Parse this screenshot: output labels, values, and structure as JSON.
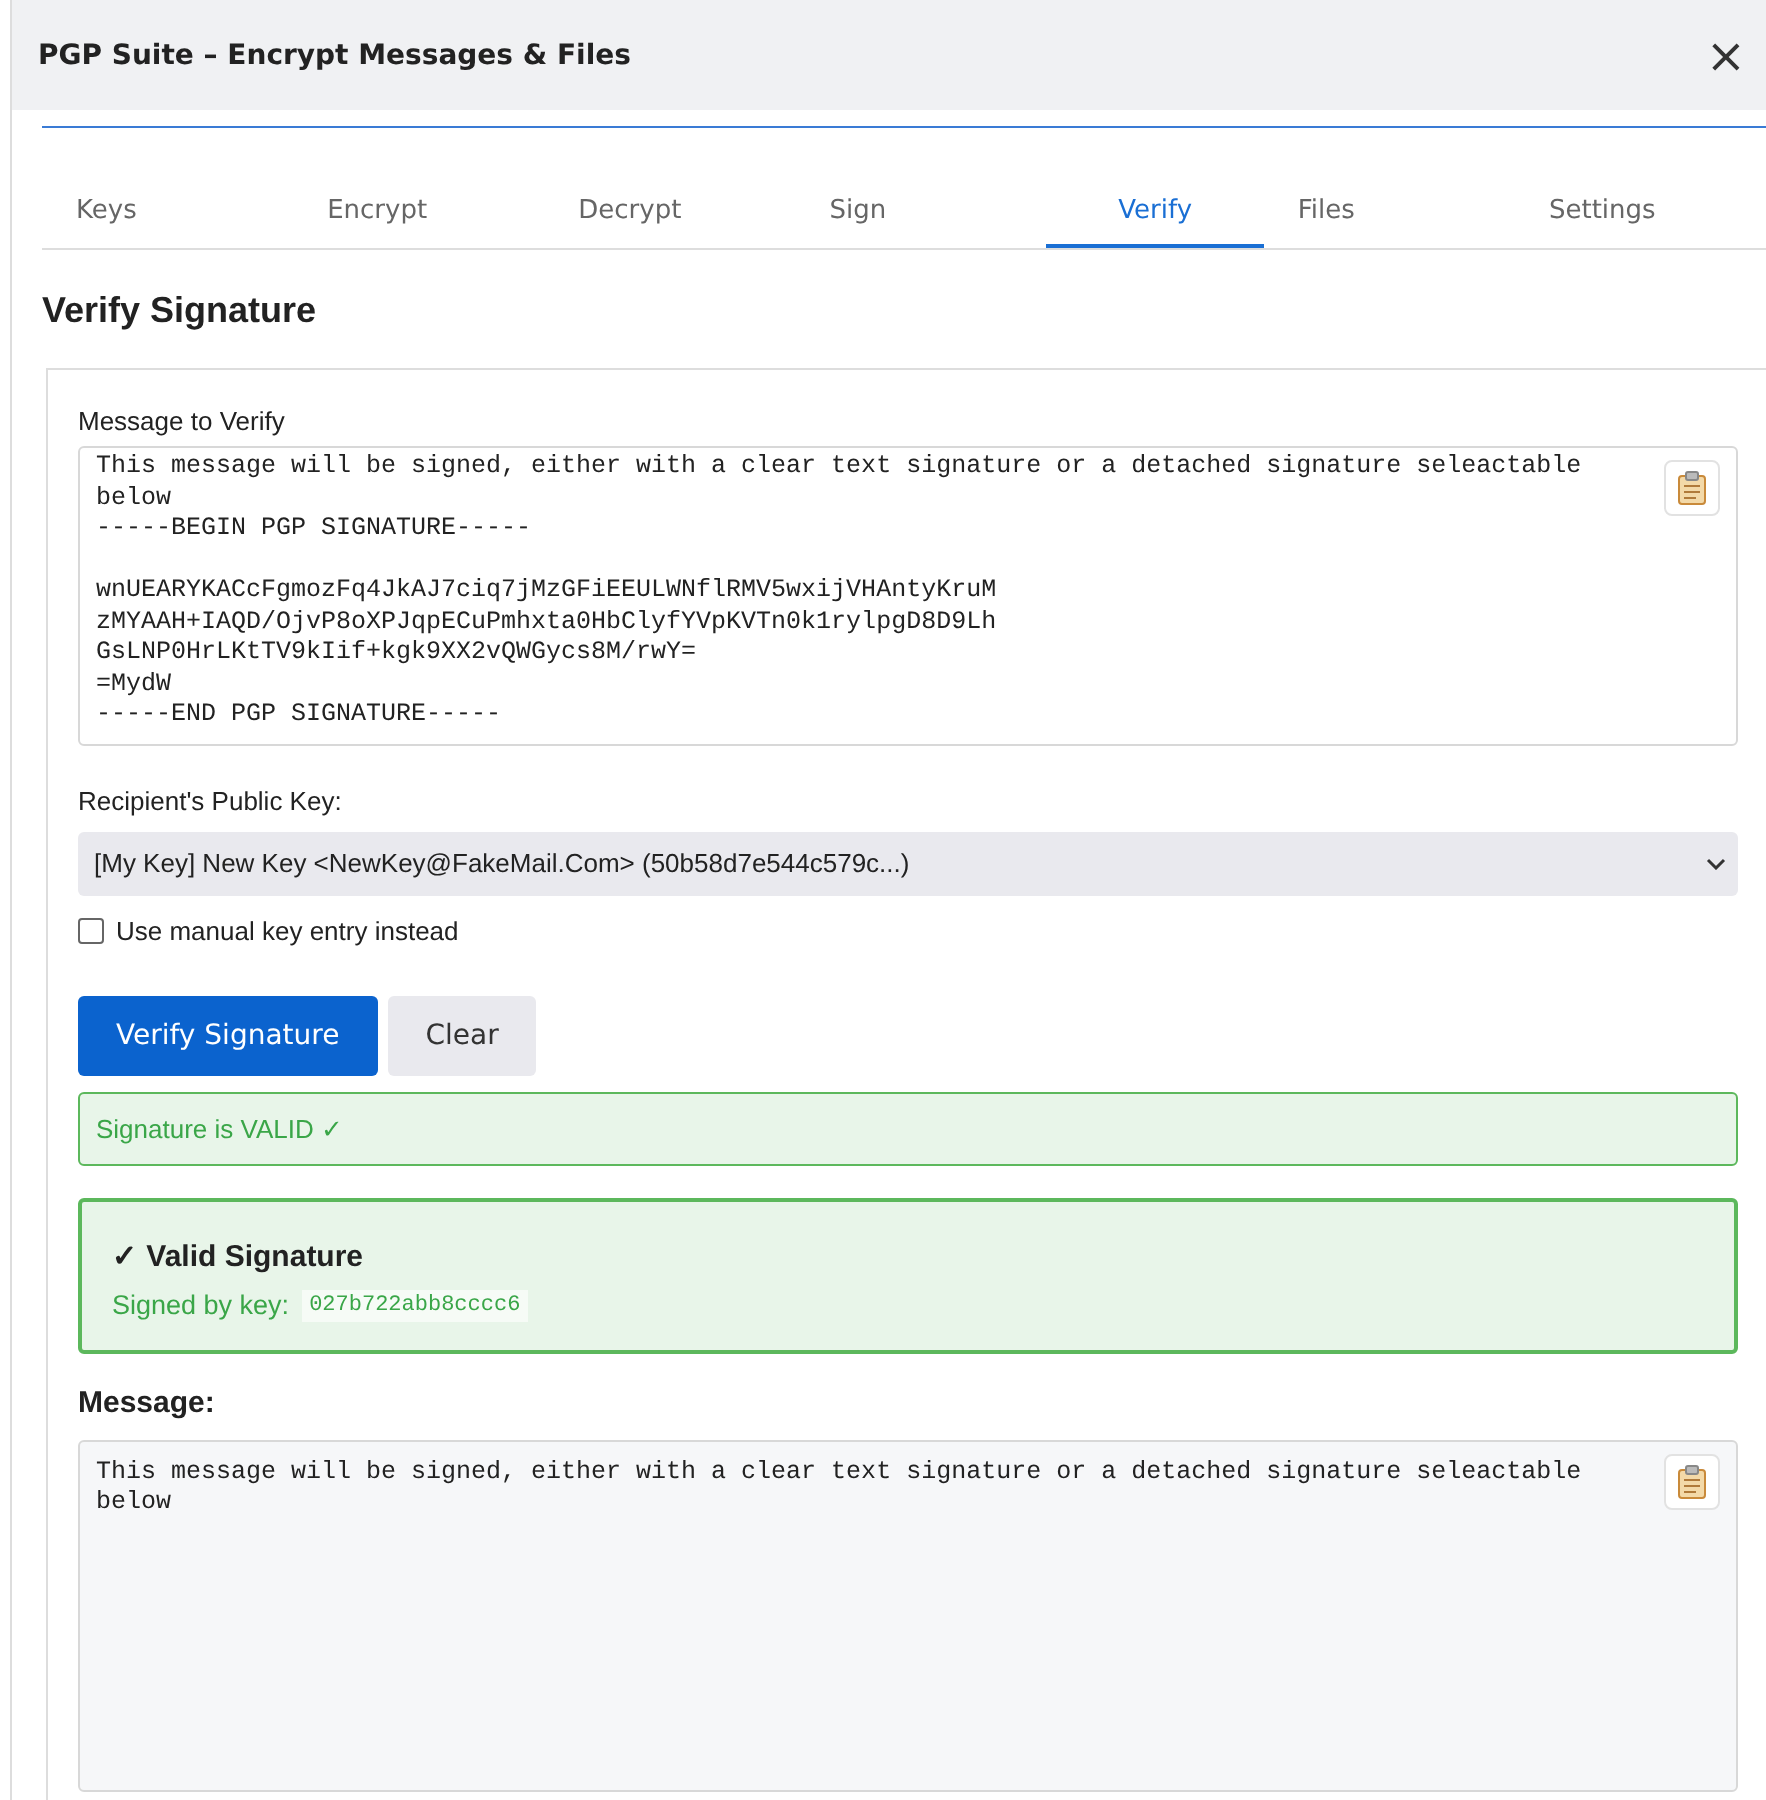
{
  "window": {
    "title": "PGP Suite – Encrypt Messages & Files",
    "close": "×"
  },
  "tabs": [
    {
      "label": "Keys",
      "selected": false
    },
    {
      "label": "Encrypt",
      "selected": false
    },
    {
      "label": "Decrypt",
      "selected": false
    },
    {
      "label": "Sign",
      "selected": false
    },
    {
      "label": "Verify",
      "selected": true
    },
    {
      "label": "Files",
      "selected": false
    },
    {
      "label": "Settings",
      "selected": false
    }
  ],
  "heading": "Verify Signature",
  "message_to_verify": {
    "label": "Message to Verify",
    "value": "This message will be signed, either with a clear text signature or a detached signature seleactable\nbelow\n-----BEGIN PGP SIGNATURE-----\n\nwnUEARYKACcFgmozFq4JkAJ7ciq7jMzGFiEEULWNflRMV5wxijVHAntyKruM\nzMYAAH+IAQD/OjvP8oXPJqpECuPmhxta0HbClyfYVpKVTn0k1rylpgD8D9Lh\nGsLNP0HrLKtTV9kIif+kgk9XX2vQWGycs8M/rwY=\n=MydW\n-----END PGP SIGNATURE-----"
  },
  "public_key": {
    "label": "Recipient's Public Key:",
    "value": "[My Key] New Key <NewKey@FakeMail.Com> (50b58d7e544c579c...)"
  },
  "manual_entry": {
    "label": "Use manual key entry instead",
    "checked": false
  },
  "buttons": [
    {
      "label": "Verify Signature",
      "kind": "primary"
    },
    {
      "label": "Clear",
      "kind": "secondary"
    }
  ],
  "status": {
    "text": "Signature is VALID ✓",
    "valid": true
  },
  "result": {
    "title": "✓ Valid Signature",
    "signed_by_label": "Signed by key:",
    "key_id": "027b722abb8cccc6"
  },
  "message": {
    "label": "Message:",
    "value": "This message will be signed, either with a clear text signature or a detached signature seleactable\nbelow"
  }
}
